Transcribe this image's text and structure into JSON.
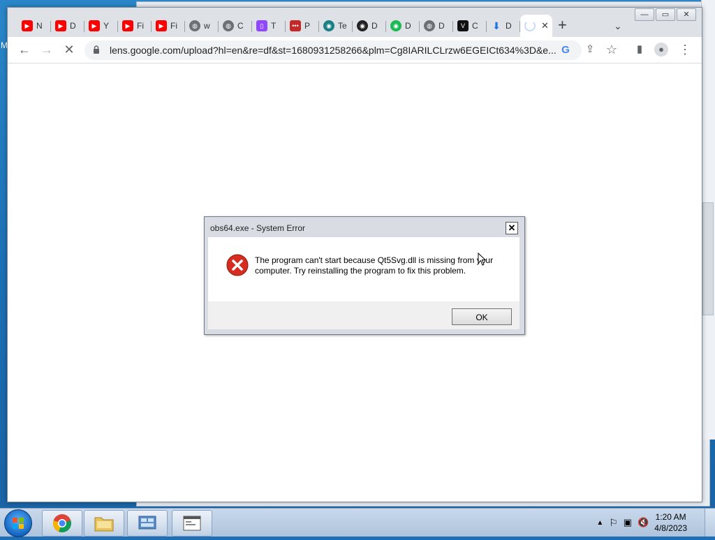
{
  "desktop": {
    "edge_label": "M"
  },
  "browser": {
    "tabs": [
      {
        "icon": "youtube-icon",
        "color": "#ff0000",
        "title": "N"
      },
      {
        "icon": "youtube-icon",
        "color": "#ff0000",
        "title": "D"
      },
      {
        "icon": "youtube-icon",
        "color": "#ff0000",
        "title": "Y"
      },
      {
        "icon": "youtube-icon",
        "color": "#ff0000",
        "title": "Fi"
      },
      {
        "icon": "youtube-icon",
        "color": "#ff0000",
        "title": "Fi"
      },
      {
        "icon": "globe-icon",
        "color": "#5f6368",
        "title": "w"
      },
      {
        "icon": "globe-icon",
        "color": "#5f6368",
        "title": "C"
      },
      {
        "icon": "twitch-icon",
        "color": "#9146ff",
        "title": "T"
      },
      {
        "icon": "pr-icon",
        "color": "#c62828",
        "title": "P"
      },
      {
        "icon": "teal-logo-icon",
        "color": "#1a7f86",
        "title": "Te"
      },
      {
        "icon": "obs-icon",
        "color": "#222222",
        "title": "D"
      },
      {
        "icon": "green-bot-icon",
        "color": "#1db954",
        "title": "D"
      },
      {
        "icon": "globe-icon",
        "color": "#5f6368",
        "title": "D"
      },
      {
        "icon": "v-logo-icon",
        "color": "#111111",
        "title": "C"
      },
      {
        "icon": "download-icon",
        "color": "#1a73e8",
        "title": "D"
      }
    ],
    "new_tab_label": "+",
    "url": "lens.google.com/upload?hl=en&re=df&st=1680931258266&plm=Cg8IARILCLrzw6EGEICt634%3D&e...",
    "window_controls": {
      "minimize": "—",
      "maximize": "▭",
      "close": "✕"
    }
  },
  "dialog": {
    "title": "obs64.exe - System Error",
    "message": "The program can't start because Qt5Svg.dll is missing from your computer. Try reinstalling the program to fix this problem.",
    "ok_label": "OK",
    "close_label": "✕"
  },
  "taskbar": {
    "apps": [
      {
        "name": "chrome",
        "icon": "chrome-icon"
      },
      {
        "name": "explorer",
        "icon": "folder-icon"
      },
      {
        "name": "control-panel",
        "icon": "control-panel-icon"
      },
      {
        "name": "window",
        "icon": "window-app-icon"
      }
    ],
    "time": "1:20 AM",
    "date": "4/8/2023"
  }
}
